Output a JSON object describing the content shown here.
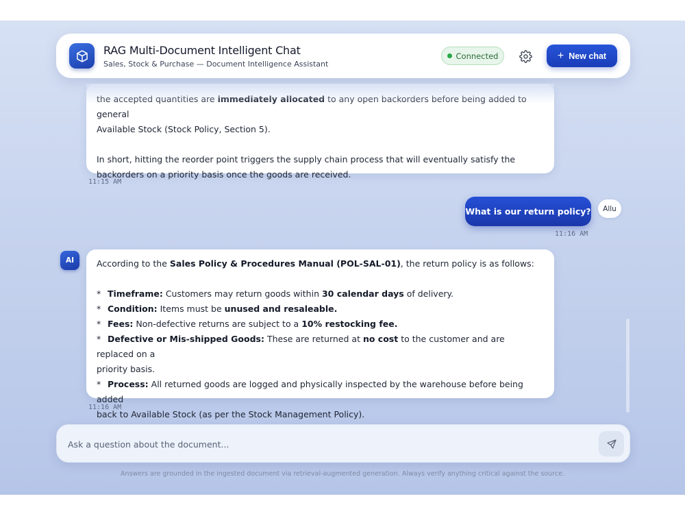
{
  "header": {
    "title": "RAG Multi-Document Intelligent Chat",
    "subtitle": "Sales, Stock & Purchase — Document Intelligence Assistant",
    "status": "Connected",
    "new_chat_label": "New chat",
    "icons": {
      "logo": "cube-icon",
      "settings": "gear-icon",
      "new_chat": "plus-icon"
    },
    "accent_color": "#1f45c8",
    "status_color": "#27a745"
  },
  "messages": [
    {
      "role": "ai",
      "time": "11:15 AM",
      "p1_a": "the accepted quantities are ",
      "p1_b": "immediately allocated",
      "p1_c": " to any open backorders before being added to general",
      "p1_d": "Available Stock (Stock Policy, Section 5).",
      "p2_a": "In short, hitting the reorder point triggers the supply chain process that will eventually satisfy the",
      "p2_b": "backorders on a priority basis once the goods are received."
    },
    {
      "role": "user",
      "avatar": "Allu",
      "text": "What is our return policy?",
      "time": "11:16 AM"
    },
    {
      "role": "ai",
      "avatar": "AI",
      "time": "11:16 AM",
      "intro_a": "According to the ",
      "intro_b": "Sales Policy & Procedures Manual (POL-SAL-01)",
      "intro_c": ", the return policy is as follows:",
      "bullets": [
        {
          "star": "*",
          "label": "Timeframe:",
          "t1": " Customers may return goods within ",
          "b1": "30 calendar days",
          "t2": " of delivery."
        },
        {
          "star": "*",
          "label": "Condition:",
          "t1": " Items must be ",
          "b1": "unused and resaleable."
        },
        {
          "star": "*",
          "label": "Fees:",
          "t1": " Non-defective returns are subject to a ",
          "b1": "10% restocking fee."
        },
        {
          "star": "*",
          "label": "Defective or Mis-shipped Goods:",
          "t1": " These are returned at ",
          "b1": "no cost",
          "t2": " to the customer and are replaced on a",
          "t3": "priority basis."
        },
        {
          "star": "*",
          "label": "Process:",
          "t1": " All returned goods are logged and physically inspected by the warehouse before being added",
          "t2": "back to Available Stock (as per the Stock Management Policy)."
        }
      ]
    }
  ],
  "input": {
    "placeholder": "Ask a question about the document...",
    "value": "",
    "send_icon": "send-icon"
  },
  "footnote": "Answers are grounded in the ingested document via retrieval-augmented generation. Always verify anything critical against the source."
}
